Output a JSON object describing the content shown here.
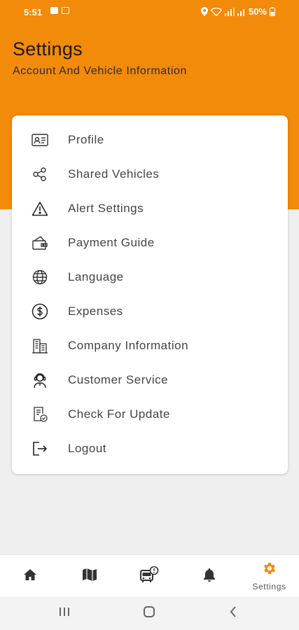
{
  "status_bar": {
    "time": "5:51",
    "battery": "50%"
  },
  "header": {
    "title": "Settings",
    "subtitle": "Account And Vehicle Information"
  },
  "menu": {
    "items": [
      {
        "label": "Profile",
        "icon": "id-card-icon"
      },
      {
        "label": "Shared Vehicles",
        "icon": "share-icon"
      },
      {
        "label": "Alert Settings",
        "icon": "warning-icon"
      },
      {
        "label": "Payment Guide",
        "icon": "wallet-icon"
      },
      {
        "label": "Language",
        "icon": "globe-icon"
      },
      {
        "label": "Expenses",
        "icon": "dollar-circle-icon"
      },
      {
        "label": "Company Information",
        "icon": "building-icon"
      },
      {
        "label": "Customer Service",
        "icon": "support-agent-icon"
      },
      {
        "label": "Check For Update",
        "icon": "update-document-icon"
      },
      {
        "label": "Logout",
        "icon": "logout-icon"
      }
    ]
  },
  "bottom_nav": {
    "items": [
      {
        "icon": "home-icon",
        "label": ""
      },
      {
        "icon": "map-icon",
        "label": ""
      },
      {
        "icon": "vehicle-alert-icon",
        "label": ""
      },
      {
        "icon": "bell-icon",
        "label": ""
      },
      {
        "icon": "gear-icon",
        "label": "Settings",
        "active": true
      }
    ]
  },
  "colors": {
    "accent": "#f28a0a",
    "background": "#efefef",
    "card": "#ffffff",
    "text": "#444444"
  }
}
